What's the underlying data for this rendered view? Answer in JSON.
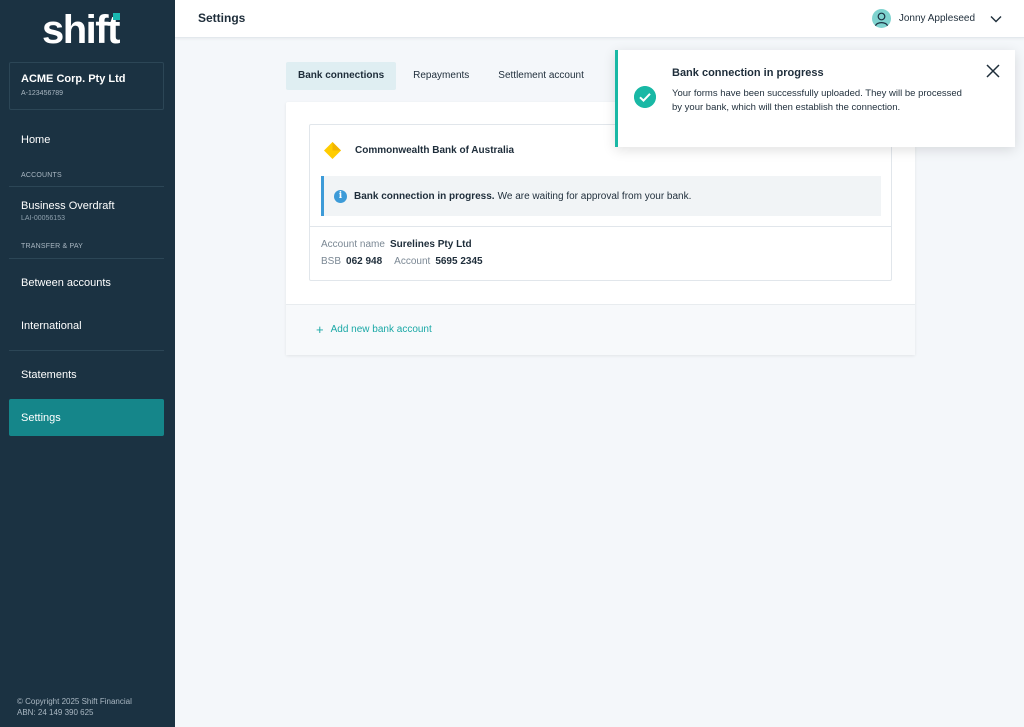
{
  "sidebar": {
    "logo": "shift",
    "org_name": "ACME Corp. Pty Ltd",
    "org_id": "A-123456789",
    "home": "Home",
    "section_accounts": "ACCOUNTS",
    "account_name": "Business Overdraft",
    "account_id": "LAI-00056153",
    "section_transfer": "TRANSFER & PAY",
    "between_accounts": "Between accounts",
    "international": "International",
    "statements": "Statements",
    "settings": "Settings",
    "copyright_line1": "© Copyright 2025 Shift Financial",
    "copyright_line2": "ABN: 24 149 390 625"
  },
  "header": {
    "title": "Settings",
    "user_name": "Jonny Appleseed"
  },
  "tabs": [
    {
      "label": "Bank connections",
      "active": true
    },
    {
      "label": "Repayments",
      "active": false
    },
    {
      "label": "Settlement account",
      "active": false
    }
  ],
  "bank_card": {
    "bank_name": "Commonwealth Bank of Australia",
    "alert_bold": "Bank connection in progress.",
    "alert_text": "We are waiting for approval from your bank.",
    "account_name_label": "Account name",
    "account_name_value": "Surelines Pty Ltd",
    "bsb_label": "BSB",
    "bsb_value": "062 948",
    "account_label": "Account",
    "account_value": "5695 2345"
  },
  "add_bank": "Add new bank account",
  "toast": {
    "title": "Bank connection in progress",
    "body": "Your forms have been successfully uploaded. They will be processed by your bank, which will then establish the connection."
  },
  "colors": {
    "sidebar_bg": "#1b3242",
    "accent_teal": "#15868a",
    "success": "#19b8a5",
    "info": "#3d9bd8",
    "cba_yellow": "#ffcc00"
  }
}
